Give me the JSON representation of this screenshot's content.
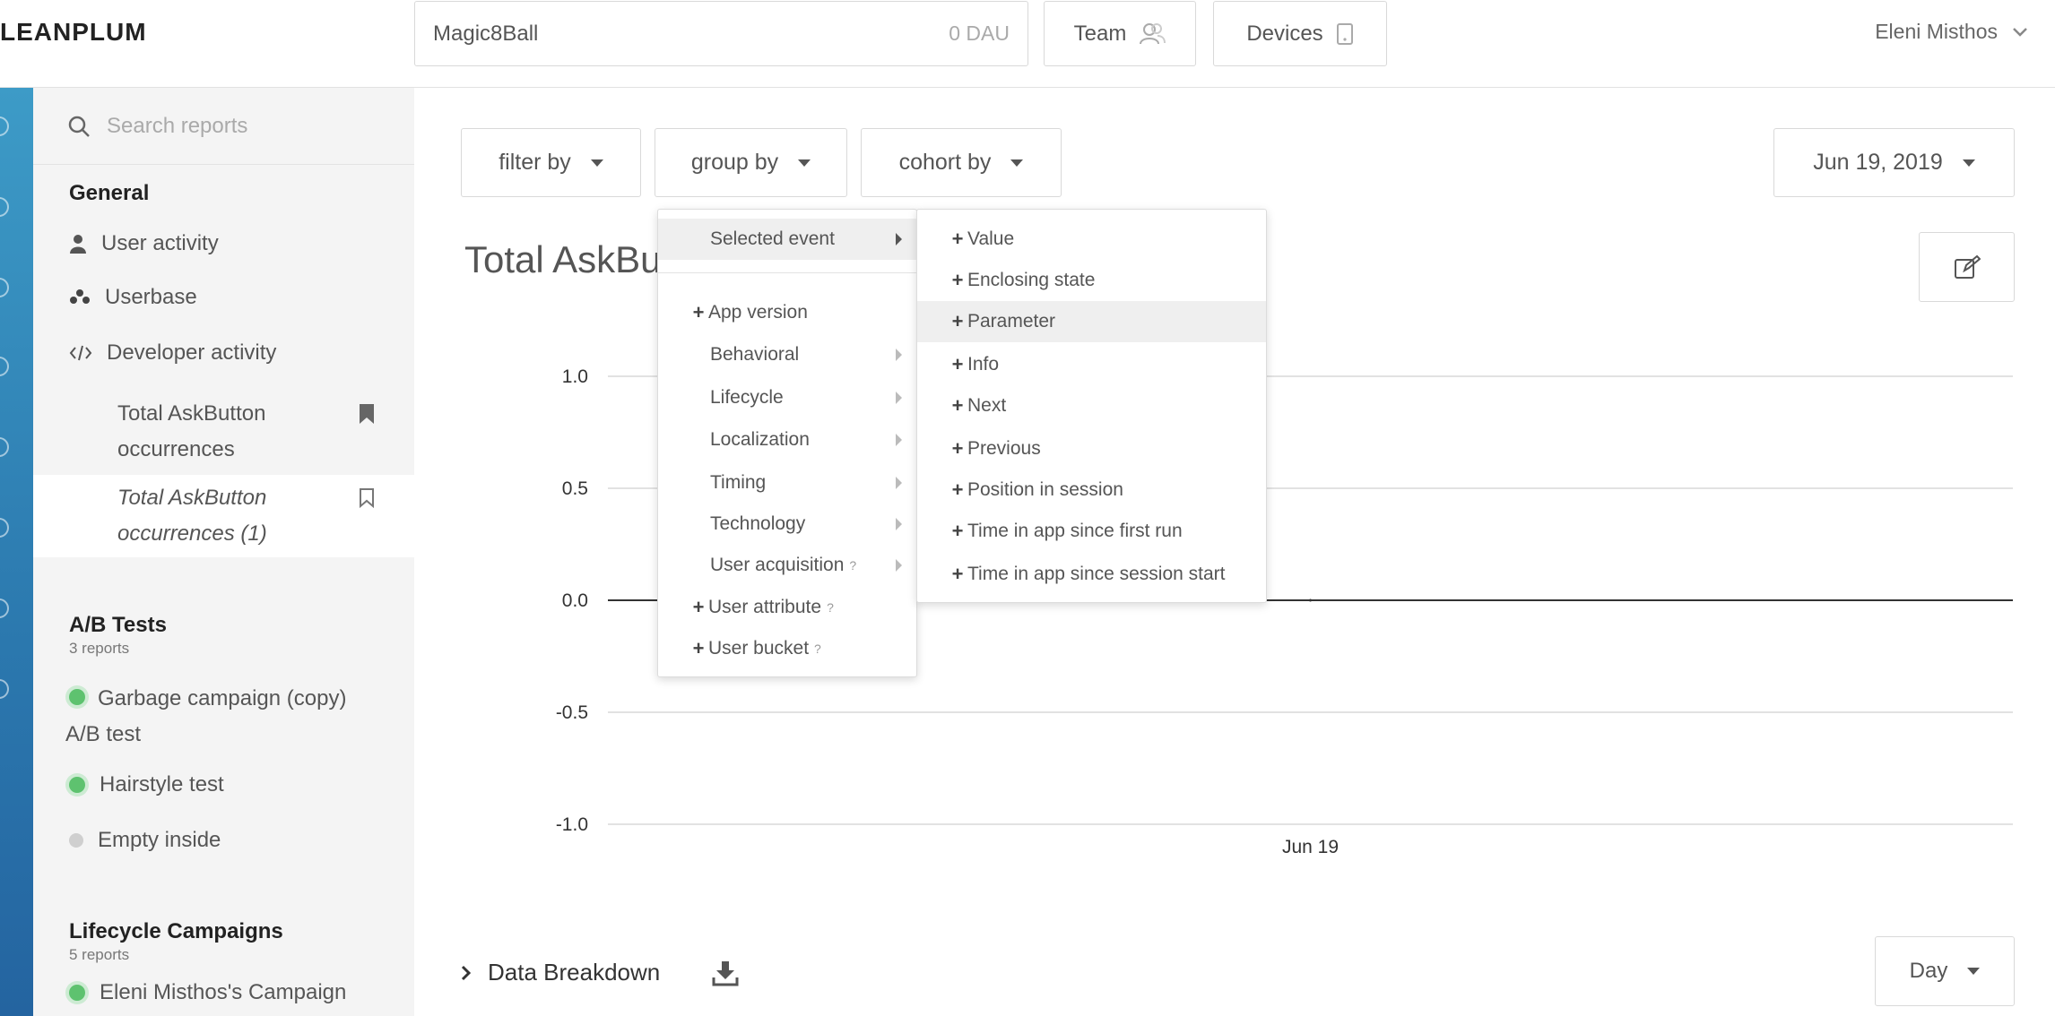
{
  "header": {
    "logo": "LEANPLUM",
    "app_name": "Magic8Ball",
    "dau": "0 DAU",
    "team_label": "Team",
    "devices_label": "Devices",
    "user_name": "Eleni Misthos"
  },
  "sidebar": {
    "search_placeholder": "Search reports",
    "general": {
      "title": "General",
      "items": [
        "User activity",
        "Userbase",
        "Developer activity"
      ],
      "reports": [
        {
          "line1": "Total AskButton",
          "line2": "occurrences"
        },
        {
          "line1": "Total AskButton",
          "line2": "occurrences (1)"
        }
      ]
    },
    "ab_tests": {
      "title": "A/B Tests",
      "sub": "3 reports",
      "items": [
        {
          "line1": "Garbage campaign (copy)",
          "line2": "A/B test"
        },
        {
          "line1": "Hairstyle test"
        },
        {
          "line1": "Empty inside"
        }
      ]
    },
    "lifecycle": {
      "title": "Lifecycle Campaigns",
      "sub": "5 reports",
      "items": [
        "Eleni Misthos's Campaign"
      ]
    }
  },
  "filters": {
    "filter_by": "filter by",
    "group_by": "group by",
    "cohort_by": "cohort by",
    "date": "Jun 19, 2019"
  },
  "chart_title": "Total AskBu",
  "chart_data": {
    "type": "line",
    "x": [
      "Jun 19"
    ],
    "series": [
      {
        "values": [
          0.0
        ]
      }
    ],
    "ylim": [
      -1.0,
      1.0
    ],
    "yticks": [
      "1.0",
      "0.5",
      "0.0",
      "-0.5",
      "-1.0"
    ],
    "grid": true
  },
  "group_menu": {
    "selected_event": "Selected event",
    "items": [
      {
        "label": "App version",
        "plus": true,
        "arrow": false,
        "q": false
      },
      {
        "label": "Behavioral",
        "plus": false,
        "arrow": true,
        "q": false
      },
      {
        "label": "Lifecycle",
        "plus": false,
        "arrow": true,
        "q": false
      },
      {
        "label": "Localization",
        "plus": false,
        "arrow": true,
        "q": false
      },
      {
        "label": "Timing",
        "plus": false,
        "arrow": true,
        "q": false
      },
      {
        "label": "Technology",
        "plus": false,
        "arrow": true,
        "q": false
      },
      {
        "label": "User acquisition",
        "plus": false,
        "arrow": true,
        "q": true
      },
      {
        "label": "User attribute",
        "plus": true,
        "arrow": false,
        "q": true
      },
      {
        "label": "User bucket",
        "plus": true,
        "arrow": false,
        "q": true
      }
    ],
    "qmark": "?"
  },
  "event_submenu": {
    "items": [
      "Value",
      "Enclosing state",
      "Parameter",
      "Info",
      "Next",
      "Previous",
      "Position in session",
      "Time in app since first run",
      "Time in app since session start"
    ],
    "highlighted": "Parameter"
  },
  "breakdown": {
    "label": "Data Breakdown",
    "interval": "Day"
  },
  "colors": {
    "accent": "#2b78ae",
    "green": "#5ec26f",
    "axis": "#333333",
    "grid": "#d9d9d9"
  }
}
